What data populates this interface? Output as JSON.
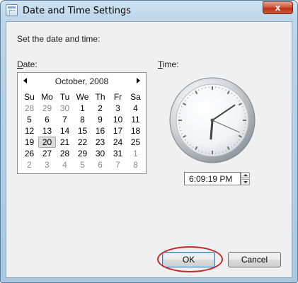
{
  "window": {
    "title": "Date and Time Settings",
    "close_label": "x"
  },
  "dialog": {
    "instruction": "Set the date and time:",
    "date_label_underlined": "D",
    "date_label_rest": "ate:",
    "time_label_underlined": "T",
    "time_label_rest": "ime:"
  },
  "calendar": {
    "month_year": "October, 2008",
    "weekdays": [
      "Su",
      "Mo",
      "Tu",
      "We",
      "Th",
      "Fr",
      "Sa"
    ],
    "weeks": [
      [
        "28",
        "29",
        "30",
        "1",
        "2",
        "3",
        "4"
      ],
      [
        "5",
        "6",
        "7",
        "8",
        "9",
        "10",
        "11"
      ],
      [
        "12",
        "13",
        "14",
        "15",
        "16",
        "17",
        "18"
      ],
      [
        "19",
        "20",
        "21",
        "22",
        "23",
        "24",
        "25"
      ],
      [
        "26",
        "27",
        "28",
        "29",
        "30",
        "31",
        "1"
      ],
      [
        "2",
        "3",
        "4",
        "5",
        "6",
        "7",
        "8"
      ]
    ],
    "selected_day": "20"
  },
  "clock": {
    "hour": 6,
    "minute": 9,
    "second": 19
  },
  "time_field": {
    "value": "6:09:19 PM"
  },
  "buttons": {
    "ok": "OK",
    "cancel": "Cancel"
  },
  "colors": {
    "highlight_ring": "#c4292a",
    "close_button": "#c8452a"
  }
}
